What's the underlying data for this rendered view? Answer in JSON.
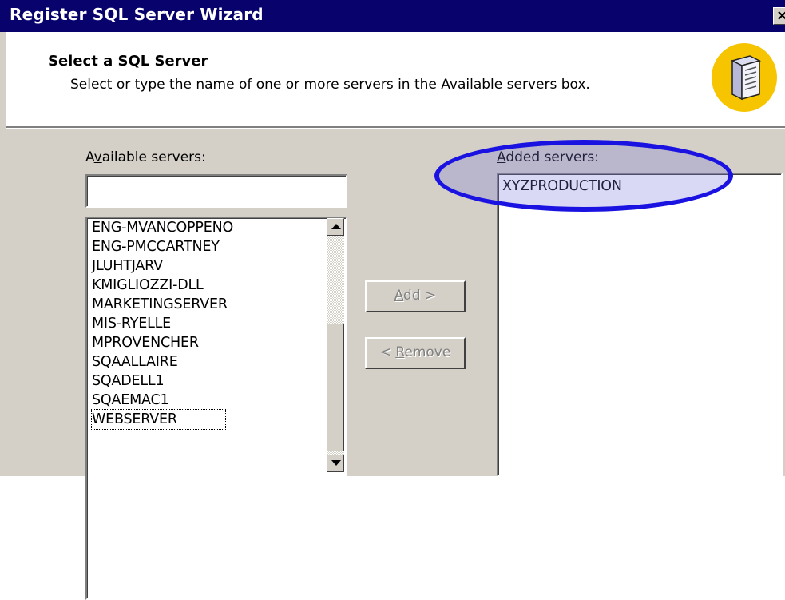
{
  "window": {
    "title": "Register SQL Server Wizard",
    "close_label": "×"
  },
  "header": {
    "title": "Select a SQL Server",
    "subtitle": "Select or type the name of one or more servers in the Available servers box.",
    "icon": "server-icon"
  },
  "available": {
    "label_before": "A",
    "label_underline": "v",
    "label_after": "ailable servers:",
    "input_value": "",
    "items": [
      "ENG-MVANCOPPENO",
      "ENG-PMCCARTNEY",
      "JLUHTJARV",
      "KMIGLIOZZI-DLL",
      "MARKETINGSERVER",
      "MIS-RYELLE",
      "MPROVENCHER",
      "SQAALLAIRE",
      "SQADELL1",
      "SQAEMAC1",
      "WEBSERVER"
    ],
    "focused_item": "WEBSERVER"
  },
  "buttons": {
    "add_underline": "A",
    "add_rest": "dd >",
    "remove_before": "< ",
    "remove_underline": "R",
    "remove_rest": "emove"
  },
  "added": {
    "label_underline": "A",
    "label_rest": "dded servers:",
    "items": [
      "XYZPRODUCTION"
    ]
  },
  "colors": {
    "titlebar": "#08036c",
    "dialog": "#d4d0c8",
    "highlight": "#1a12e0",
    "badge": "#f6c500"
  }
}
